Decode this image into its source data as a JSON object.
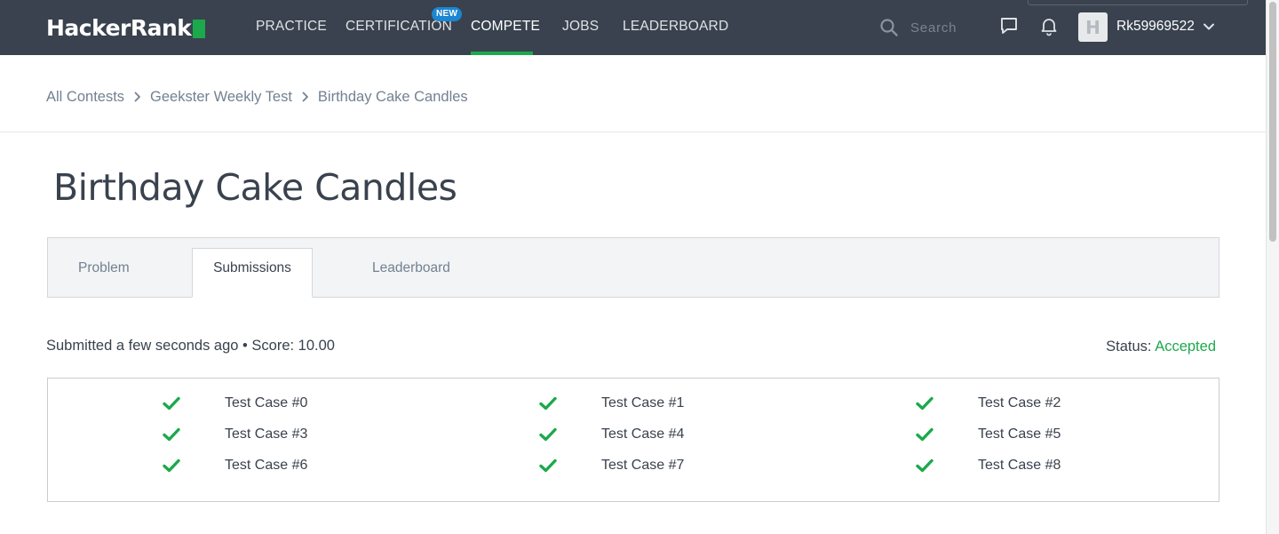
{
  "nav": {
    "logo": "HackerRank",
    "items": [
      {
        "label": "PRACTICE"
      },
      {
        "label": "CERTIFICATION"
      },
      {
        "label": "COMPETE"
      },
      {
        "label": "JOBS"
      },
      {
        "label": "LEADERBOARD"
      }
    ],
    "active_item": "COMPETE",
    "new_badge": "NEW",
    "search_placeholder": "Search",
    "avatar_letter": "H",
    "username": "Rk59969522"
  },
  "breadcrumb": [
    "All Contests",
    "Geekster Weekly Test",
    "Birthday Cake Candles"
  ],
  "page": {
    "title": "Birthday Cake Candles"
  },
  "tabs": [
    {
      "label": "Problem"
    },
    {
      "label": "Submissions"
    },
    {
      "label": "Leaderboard"
    }
  ],
  "active_tab": "Submissions",
  "submission": {
    "summary": "Submitted a few seconds ago • Score: 10.00",
    "status_label": "Status:",
    "status_value": "Accepted"
  },
  "test_cases": [
    {
      "label": "Test Case #0",
      "passed": true
    },
    {
      "label": "Test Case #1",
      "passed": true
    },
    {
      "label": "Test Case #2",
      "passed": true
    },
    {
      "label": "Test Case #3",
      "passed": true
    },
    {
      "label": "Test Case #4",
      "passed": true
    },
    {
      "label": "Test Case #5",
      "passed": true
    },
    {
      "label": "Test Case #6",
      "passed": true
    },
    {
      "label": "Test Case #7",
      "passed": true
    },
    {
      "label": "Test Case #8",
      "passed": true
    }
  ],
  "colors": {
    "nav_bg": "#39424e",
    "accent_green": "#1ba94c",
    "badge_blue": "#1c86d1",
    "muted_text": "#738191"
  }
}
